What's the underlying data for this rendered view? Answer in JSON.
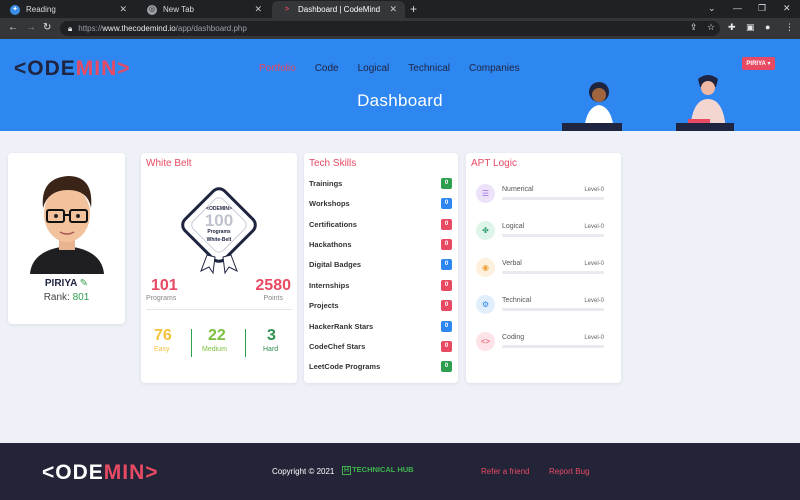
{
  "browser": {
    "tabs": [
      {
        "title": "Reading"
      },
      {
        "title": "New Tab"
      },
      {
        "title": "Dashboard | CodeMind"
      }
    ],
    "url_prefix": "https://",
    "url_host": "www.thecodemind.io",
    "url_path": "/app/dashboard.php"
  },
  "site": {
    "logo_left": "<ODE",
    "logo_right": "MIN>",
    "nav": [
      "Portfolio",
      "Code",
      "Logical",
      "Technical",
      "Companies"
    ],
    "page_title": "Dashboard",
    "user_button": "PIRIYA"
  },
  "profile": {
    "name": "PIRIYA",
    "rank_label": "Rank:",
    "rank": "801"
  },
  "belt": {
    "title": "White Belt",
    "badge_brand": "<ODEMIN>",
    "badge_number": "100",
    "badge_sub": "Programs",
    "badge_belt": "White-Belt",
    "programs_value": "101",
    "programs_label": "Programs",
    "points_value": "2580",
    "points_label": "Points",
    "levels": [
      {
        "value": "76",
        "label": "Easy",
        "color": "#f3c13a"
      },
      {
        "value": "22",
        "label": "Medium",
        "color": "#7bbf3f"
      },
      {
        "value": "3",
        "label": "Hard",
        "color": "#2e8f4f"
      }
    ]
  },
  "skills": {
    "title": "Tech Skills",
    "items": [
      {
        "label": "Trainings",
        "count": "0",
        "color": "#2e9e4f"
      },
      {
        "label": "Workshops",
        "count": "0",
        "color": "#2e86f0"
      },
      {
        "label": "Certifications",
        "count": "0",
        "color": "#e84a64"
      },
      {
        "label": "Hackathons",
        "count": "0",
        "color": "#e84a64"
      },
      {
        "label": "Digital Badges",
        "count": "0",
        "color": "#2e86f0"
      },
      {
        "label": "Internships",
        "count": "0",
        "color": "#e84a64"
      },
      {
        "label": "Projects",
        "count": "0",
        "color": "#e84a64"
      },
      {
        "label": "HackerRank Stars",
        "count": "0",
        "color": "#2e86f0"
      },
      {
        "label": "CodeChef Stars",
        "count": "0",
        "color": "#e84a64"
      },
      {
        "label": "LeetCode Programs",
        "count": "0",
        "color": "#2e9e4f"
      }
    ]
  },
  "apt": {
    "title": "APT Logic",
    "items": [
      {
        "label": "Numerical",
        "level": "Level-0",
        "icon": "list-icon",
        "bg": "#ece3fb",
        "fg": "#9b6ee0"
      },
      {
        "label": "Logical",
        "level": "Level-0",
        "icon": "puzzle-icon",
        "bg": "#dff5ea",
        "fg": "#2e9e6f"
      },
      {
        "label": "Verbal",
        "level": "Level-0",
        "icon": "chat-icon",
        "bg": "#fdf0dc",
        "fg": "#f0a03a"
      },
      {
        "label": "Technical",
        "level": "Level-0",
        "icon": "gears-icon",
        "bg": "#e1eefc",
        "fg": "#2e86f0"
      },
      {
        "label": "Coding",
        "level": "Level-0",
        "icon": "code-icon",
        "bg": "#fde3e7",
        "fg": "#e84a64"
      }
    ]
  },
  "footer": {
    "logo_left": "<ODE",
    "logo_right": "MIN>",
    "copyright": "Copyright © 2021",
    "brand_letter": "H",
    "brand_text": "TECHNICAL HUB",
    "links": [
      "Refer a friend",
      "Report Bug"
    ]
  },
  "colors": {
    "accent": "#e84a64",
    "header_blue": "#2e86f0",
    "navy": "#1f2440",
    "footer_bg": "#232438"
  }
}
